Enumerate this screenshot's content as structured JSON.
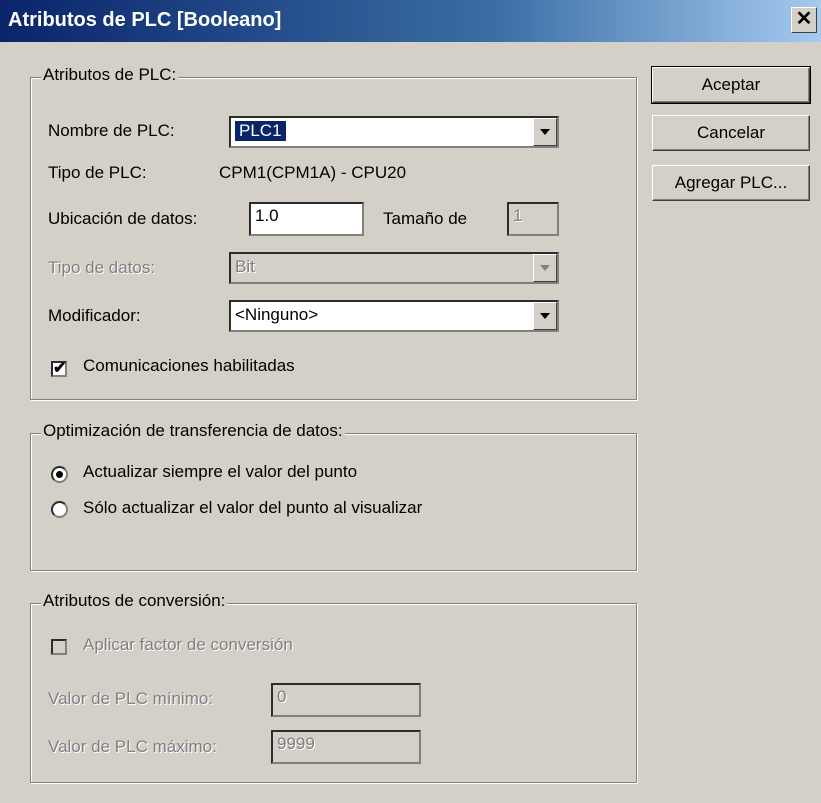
{
  "window": {
    "title": "Atributos de PLC [Booleano]",
    "close_glyph": "✕"
  },
  "buttons": {
    "ok": "Aceptar",
    "cancel": "Cancelar",
    "add_plc": "Agregar PLC..."
  },
  "plc_group": {
    "legend": "Atributos de PLC:",
    "name_label": "Nombre de PLC:",
    "name_value": "PLC1",
    "type_label": "Tipo de PLC:",
    "type_value": "CPM1(CPM1A) - CPU20",
    "location_label": "Ubicación de datos:",
    "location_value": "1.0",
    "size_label": "Tamaño de",
    "size_value": "1",
    "datatype_label": "Tipo de datos:",
    "datatype_value": "Bit",
    "modifier_label": "Modificador:",
    "modifier_value": "<Ninguno>",
    "comms_label": "Comunicaciones habilitadas",
    "comms_checked": true
  },
  "optimization_group": {
    "legend": "Optimización de transferencia de datos:",
    "option_always": "Actualizar siempre el valor del punto",
    "option_visible": "Sólo actualizar el valor del punto al visualizar",
    "selected": "always"
  },
  "conversion_group": {
    "legend": "Atributos de conversión:",
    "apply_label": "Aplicar factor de conversión",
    "apply_checked": false,
    "min_label": "Valor de PLC mínimo:",
    "min_value": "0",
    "max_label": "Valor de PLC máximo:",
    "max_value": "9999"
  },
  "colors": {
    "face": "#d4d0c8",
    "title_start": "#0a246a",
    "title_end": "#a6caf0",
    "highlight": "#0a246a"
  }
}
